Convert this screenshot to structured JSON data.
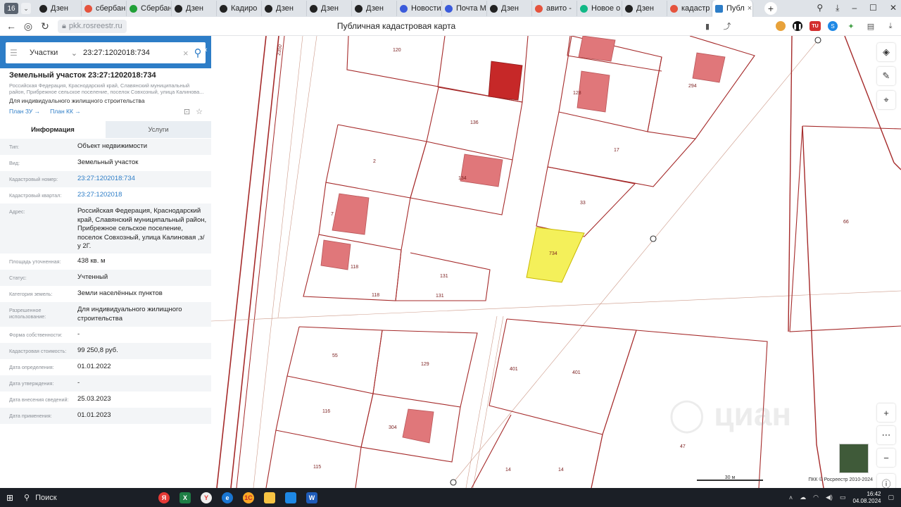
{
  "browser": {
    "tab_counter": "16",
    "tabs": [
      {
        "label": "Дзен",
        "color": "#222222"
      },
      {
        "label": "сбербан",
        "color": "#e5533d"
      },
      {
        "label": "Сбербан",
        "color": "#21a038"
      },
      {
        "label": "Дзен",
        "color": "#222222"
      },
      {
        "label": "Кадиро",
        "color": "#222222"
      },
      {
        "label": "Дзен",
        "color": "#222222"
      },
      {
        "label": "Дзен",
        "color": "#222222"
      },
      {
        "label": "Дзен",
        "color": "#222222"
      },
      {
        "label": "Новости",
        "color": "#3b5bdb"
      },
      {
        "label": "Почта М",
        "color": "#3b5bdb"
      },
      {
        "label": "Дзен",
        "color": "#222222"
      },
      {
        "label": "авито -",
        "color": "#e5533d"
      },
      {
        "label": "Новое о",
        "color": "#12b886"
      },
      {
        "label": "Дзен",
        "color": "#222222"
      },
      {
        "label": "кадастр",
        "color": "#e5533d"
      }
    ],
    "active_tab": "Публ",
    "url": "pkk.rosreestr.ru",
    "page_title": "Публичная кадастровая карта"
  },
  "search": {
    "type": "Участки",
    "value": "23:27:1202018:734"
  },
  "card": {
    "title": "Земельный участок 23:27:1202018:734",
    "address_line": "Российская Федерация, Краснодарский край, Славянский муниципальный район, Прибрежное сельское поселение, поселок Совхозный, улица Калинова...",
    "use": "Для индивидуального жилищного строительства",
    "link_plan_zu": "План ЗУ →",
    "link_plan_kk": "План КК →",
    "tab_info": "Информация",
    "tab_services": "Услуги"
  },
  "attributes": [
    {
      "key": "Тип:",
      "value": "Объект недвижимости",
      "link": false
    },
    {
      "key": "Вид:",
      "value": "Земельный участок",
      "link": false
    },
    {
      "key": "Кадастровый номер:",
      "value": "23:27:1202018:734",
      "link": true
    },
    {
      "key": "Кадастровый квартал:",
      "value": "23:27:1202018",
      "link": true
    },
    {
      "key": "Адрес:",
      "value": "Российская Федерация, Краснодарский край, Славянский муниципальный район, Прибрежное сельское поселение, поселок Совхозный, улица Калиновая ,з/у 2Г.",
      "link": false
    },
    {
      "key": "Площадь уточненная:",
      "value": "438 кв. м",
      "link": false
    },
    {
      "key": "Статус:",
      "value": "Учтенный",
      "link": false
    },
    {
      "key": "Категория земель:",
      "value": "Земли населённых пунктов",
      "link": false
    },
    {
      "key": "Разрешенное использование:",
      "value": "Для индивидуального жилищного строительства",
      "link": false
    },
    {
      "key": "Форма собственности:",
      "value": "-",
      "link": false
    },
    {
      "key": "Кадастровая стоимость:",
      "value": "99 250,8 руб.",
      "link": false
    },
    {
      "key": "Дата определения:",
      "value": "01.01.2022",
      "link": false
    },
    {
      "key": "Дата утверждения:",
      "value": "-",
      "link": false
    },
    {
      "key": "Дата внесения сведений:",
      "value": "25.03.2023",
      "link": false
    },
    {
      "key": "Дата применения:",
      "value": "01.01.2023",
      "link": false
    }
  ],
  "map": {
    "parcel_labels": [
      {
        "text": "120"
      },
      {
        "text": "136"
      },
      {
        "text": "2"
      },
      {
        "text": "134"
      },
      {
        "text": "7"
      },
      {
        "text": "118"
      },
      {
        "text": "131"
      },
      {
        "text": "131"
      },
      {
        "text": "118"
      },
      {
        "text": "128"
      },
      {
        "text": "294"
      },
      {
        "text": "17"
      },
      {
        "text": "33"
      },
      {
        "text": "734"
      },
      {
        "text": "66"
      },
      {
        "text": "55"
      },
      {
        "text": "129"
      },
      {
        "text": "116"
      },
      {
        "text": "304"
      },
      {
        "text": "115"
      },
      {
        "text": "401"
      },
      {
        "text": "401"
      },
      {
        "text": "47"
      },
      {
        "text": "14"
      },
      {
        "text": "14"
      },
      {
        "text": "2350"
      }
    ],
    "scale_label": "30 м",
    "copyright": "ПКК © Росреестр 2010-2024",
    "highlight_color": "#f4f05a",
    "parcel_border_color": "#a52a2a",
    "building_color": "#e0777a"
  },
  "taskbar": {
    "search_label": "Поиск",
    "time": "16:42",
    "date": "04.08.2024"
  }
}
